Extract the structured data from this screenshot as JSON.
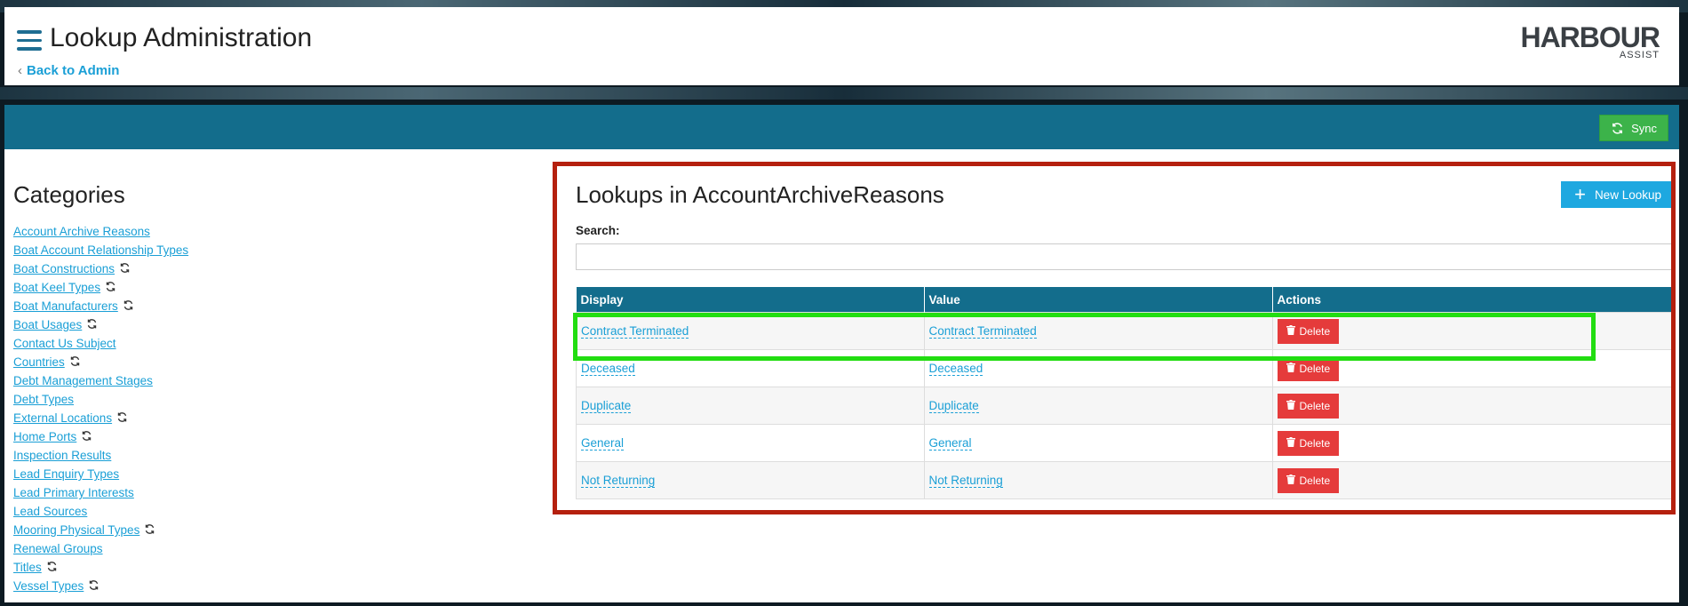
{
  "header": {
    "title": "Lookup Administration",
    "back_label": "Back to Admin",
    "logo_main": "HARBOUR",
    "logo_sub": "ASSIST"
  },
  "toolbar": {
    "sync_label": "Sync"
  },
  "categories": {
    "title": "Categories",
    "items": [
      {
        "label": "Account Archive Reasons",
        "sync": false
      },
      {
        "label": "Boat Account Relationship Types",
        "sync": false
      },
      {
        "label": "Boat Constructions",
        "sync": true
      },
      {
        "label": "Boat Keel Types",
        "sync": true
      },
      {
        "label": "Boat Manufacturers",
        "sync": true
      },
      {
        "label": "Boat Usages",
        "sync": true
      },
      {
        "label": "Contact Us Subject",
        "sync": false
      },
      {
        "label": "Countries",
        "sync": true
      },
      {
        "label": "Debt Management Stages",
        "sync": false
      },
      {
        "label": "Debt Types",
        "sync": false
      },
      {
        "label": "External Locations",
        "sync": true
      },
      {
        "label": "Home Ports",
        "sync": true
      },
      {
        "label": "Inspection Results",
        "sync": false
      },
      {
        "label": "Lead Enquiry Types",
        "sync": false
      },
      {
        "label": "Lead Primary Interests",
        "sync": false
      },
      {
        "label": "Lead Sources",
        "sync": false
      },
      {
        "label": "Mooring Physical Types",
        "sync": true
      },
      {
        "label": "Renewal Groups",
        "sync": false
      },
      {
        "label": "Titles",
        "sync": true
      },
      {
        "label": "Vessel Types",
        "sync": true
      }
    ]
  },
  "lookups": {
    "title": "Lookups in AccountArchiveReasons",
    "new_label": "New Lookup",
    "search_label": "Search:",
    "search_value": "",
    "columns": [
      "Display",
      "Value",
      "Actions"
    ],
    "delete_label": "Delete",
    "rows": [
      {
        "display": "Contract Terminated",
        "value": "Contract Terminated"
      },
      {
        "display": "Deceased",
        "value": "Deceased"
      },
      {
        "display": "Duplicate",
        "value": "Duplicate"
      },
      {
        "display": "General",
        "value": "General"
      },
      {
        "display": "Not Returning",
        "value": "Not Returning"
      }
    ]
  },
  "colors": {
    "accent": "#136d8c",
    "link": "#1a9fd6",
    "sync_button": "#3cb34a",
    "new_button": "#1ea8e0",
    "delete_button": "#e53b3b",
    "highlight_panel": "#b5200e",
    "highlight_row": "#22dd11"
  }
}
